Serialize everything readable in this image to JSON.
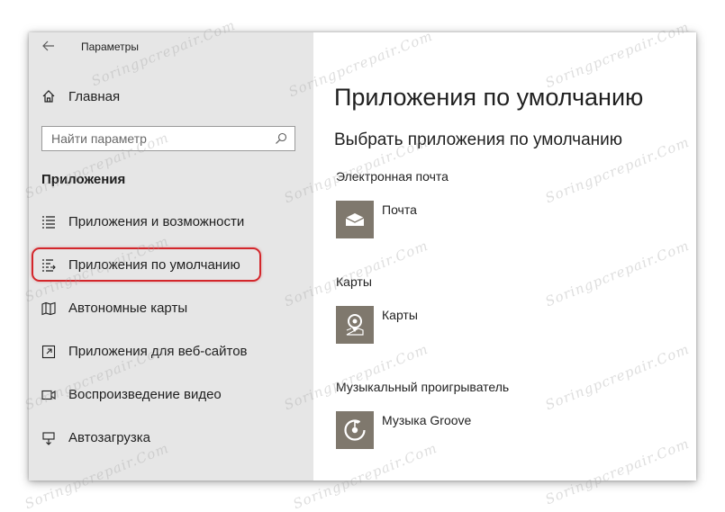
{
  "window": {
    "title": "Параметры"
  },
  "sidebar": {
    "home_label": "Главная",
    "search_placeholder": "Найти параметр",
    "section_heading": "Приложения",
    "items": [
      {
        "label": "Приложения и возможности",
        "icon": "apps-list-icon"
      },
      {
        "label": "Приложения по умолчанию",
        "icon": "default-apps-icon",
        "selected": true
      },
      {
        "label": "Автономные карты",
        "icon": "offline-map-icon"
      },
      {
        "label": "Приложения для веб-сайтов",
        "icon": "web-link-icon"
      },
      {
        "label": "Воспроизведение видео",
        "icon": "video-playback-icon"
      },
      {
        "label": "Автозагрузка",
        "icon": "startup-icon"
      }
    ]
  },
  "main": {
    "title": "Приложения по умолчанию",
    "subtitle": "Выбрать приложения по умолчанию",
    "categories": [
      {
        "label": "Электронная почта",
        "app": "Почта",
        "icon": "mail-icon"
      },
      {
        "label": "Карты",
        "app": "Карты",
        "icon": "maps-pin-icon"
      },
      {
        "label": "Музыкальный проигрыватель",
        "app": "Музыка Groove",
        "icon": "groove-music-icon"
      }
    ]
  },
  "watermark": "Soringpcrepair.Com",
  "colors": {
    "sidebar_bg": "#e6e6e6",
    "tile_bg": "#7f786d",
    "highlight": "#d3262b"
  }
}
